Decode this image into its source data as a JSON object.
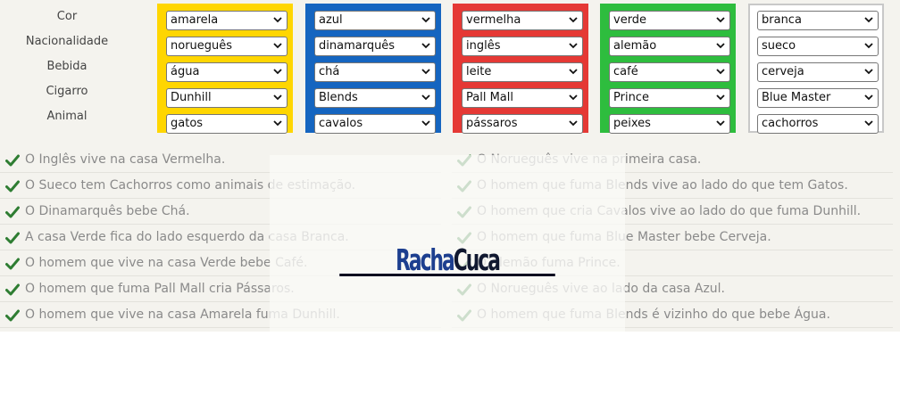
{
  "labels": [
    "Cor",
    "Nacionalidade",
    "Bebida",
    "Cigarro",
    "Animal"
  ],
  "houses": [
    {
      "color": "#ffd600",
      "selections": [
        "amarela",
        "norueguês",
        "água",
        "Dunhill",
        "gatos"
      ]
    },
    {
      "color": "#1565c0",
      "selections": [
        "azul",
        "dinamarquês",
        "chá",
        "Blends",
        "cavalos"
      ]
    },
    {
      "color": "#e53935",
      "selections": [
        "vermelha",
        "inglês",
        "leite",
        "Pall Mall",
        "pássaros"
      ]
    },
    {
      "color": "#2ebd3e",
      "selections": [
        "verde",
        "alemão",
        "café",
        "Prince",
        "peixes"
      ]
    },
    {
      "color": "#c8c8c8",
      "selections": [
        "branca",
        "sueco",
        "cerveja",
        "Blue Master",
        "cachorros"
      ]
    }
  ],
  "clues_left": [
    "O Inglês vive na casa Vermelha.",
    "O Sueco tem Cachorros como animais de estimação.",
    "O Dinamarquês bebe Chá.",
    "A casa Verde fica do lado esquerdo da casa Branca.",
    "O homem que vive na casa Verde bebe Café.",
    "O homem que fuma Pall Mall cria Pássaros.",
    "O homem que vive na casa Amarela fuma Dunhill."
  ],
  "clues_right": [
    "O Norueguês vive na primeira casa.",
    "O homem que fuma Blends vive ao lado do que tem Gatos.",
    "O homem que cria Cavalos vive ao lado do que fuma Dunhill.",
    "O homem que fuma Blue Master bebe Cerveja.",
    "O Alemão fuma Prince.",
    "O Norueguês vive ao lado da casa Azul.",
    "O homem que fuma Blends é vizinho do que bebe Água."
  ],
  "clue_check_color": "#2e7d32",
  "logo": {
    "part1": "Racha",
    "part2": "Cuca"
  },
  "icons": {
    "check": "check-icon",
    "dropdown": "chevron-down-icon"
  }
}
